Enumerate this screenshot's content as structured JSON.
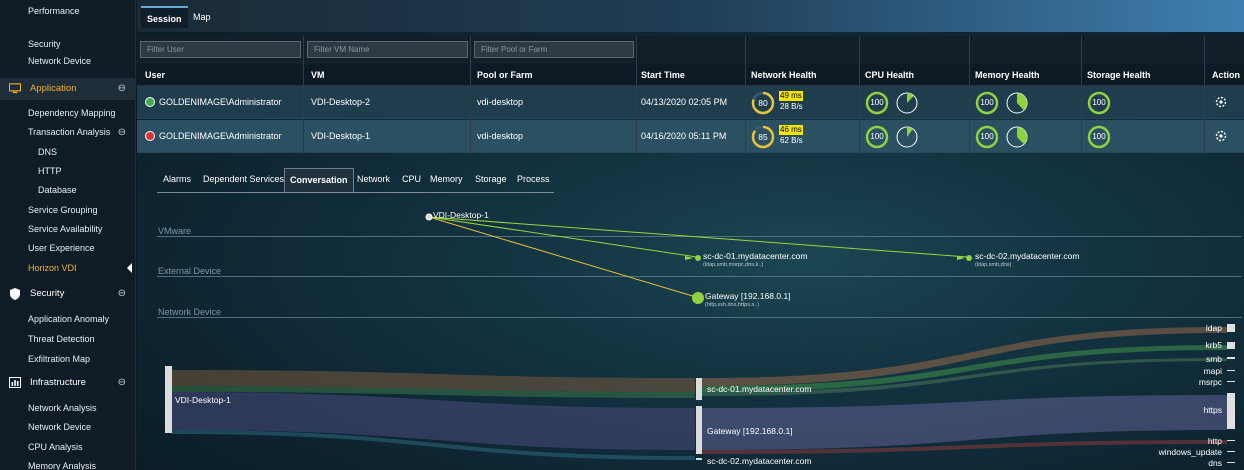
{
  "sidebar": {
    "items": [
      {
        "label": "Performance",
        "type": "item"
      },
      {
        "label": "Security",
        "type": "item"
      },
      {
        "label": "Network Device",
        "type": "item"
      },
      {
        "label": "Application",
        "type": "section",
        "icon": "monitor-icon",
        "active": true
      },
      {
        "label": "Dependency Mapping",
        "type": "item"
      },
      {
        "label": "Transaction Analysis",
        "type": "item-collapsible"
      },
      {
        "label": "DNS",
        "type": "sub"
      },
      {
        "label": "HTTP",
        "type": "sub"
      },
      {
        "label": "Database",
        "type": "sub"
      },
      {
        "label": "Service Grouping",
        "type": "item"
      },
      {
        "label": "Service Availability",
        "type": "item"
      },
      {
        "label": "User Experience",
        "type": "item"
      },
      {
        "label": "Horizon VDI",
        "type": "item",
        "active": true
      },
      {
        "label": "Security",
        "type": "section",
        "icon": "shield-icon"
      },
      {
        "label": "Application Anomaly",
        "type": "item"
      },
      {
        "label": "Threat Detection",
        "type": "item"
      },
      {
        "label": "Exfiltration Map",
        "type": "item"
      },
      {
        "label": "Infrastructure",
        "type": "section",
        "icon": "bar-chart-icon"
      },
      {
        "label": "Network Analysis",
        "type": "item"
      },
      {
        "label": "Network Device",
        "type": "item"
      },
      {
        "label": "CPU Analysis",
        "type": "item"
      },
      {
        "label": "Memory Analysis",
        "type": "item"
      }
    ],
    "collapse_glyph": "⊖"
  },
  "tabs": {
    "session": "Session",
    "map": "Map"
  },
  "filters": {
    "user": "Filter User",
    "vm": "Filter VM Name",
    "pool": "Filter Pool or Farm"
  },
  "columns": [
    "User",
    "VM",
    "Pool or Farm",
    "Start Time",
    "Network Health",
    "CPU Health",
    "Memory Health",
    "Storage Health",
    "Action"
  ],
  "rows": [
    {
      "status": "ok",
      "user": "GOLDENIMAGE\\Administrator",
      "vm": "VDI-Desktop-2",
      "pool": "vdi-desktop",
      "start": "04/13/2020 02:05 PM",
      "net_score": "80",
      "latency": "49 ms",
      "throughput": "28 B/s",
      "cpu_score": "100",
      "cpu_pie": 0.12,
      "mem_score": "100",
      "mem_pie": 0.38,
      "storage_score": "100"
    },
    {
      "status": "bad",
      "user": "GOLDENIMAGE\\Administrator",
      "vm": "VDI-Desktop-1",
      "pool": "vdi-desktop",
      "start": "04/16/2020 05:11 PM",
      "net_score": "85",
      "latency": "46 ms",
      "throughput": "62 B/s",
      "cpu_score": "100",
      "cpu_pie": 0.1,
      "mem_score": "100",
      "mem_pie": 0.38,
      "storage_score": "100"
    }
  ],
  "detail_tabs": [
    "Alarms",
    "Dependent Services",
    "Conversation",
    "Network",
    "CPU",
    "Memory",
    "Storage",
    "Process"
  ],
  "detail_active": "Conversation",
  "graph": {
    "lanes": [
      "VMware",
      "External Device",
      "Network Device"
    ],
    "source": "VDI-Desktop-1",
    "dc01": {
      "name": "sc-dc-01.mydatacenter.com",
      "protocols": "(ldap,smb,msrpc,dns,k..)"
    },
    "dc02": {
      "name": "sc-dc-02.mydatacenter.com",
      "protocols": "(ldap,smb,dns)"
    },
    "gateway": {
      "name": "Gateway [192.168.0.1]",
      "protocols": "(http,ssh,dns,https,s..)"
    }
  },
  "sankey": {
    "source": "VDI-Desktop-1",
    "middle": [
      "sc-dc-01.mydatacenter.com",
      "Gateway [192.168.0.1]",
      "sc-dc-02.mydatacenter.com"
    ],
    "right": [
      "ldap",
      "krb5",
      "smb",
      "mapi",
      "msrpc",
      "https",
      "http",
      "windows_update",
      "dns"
    ]
  },
  "colors": {
    "accent": "#f2b12c",
    "health_ring": "#8fd13f",
    "latency_bg": "#f5e600",
    "link_green": "#9ed43c",
    "link_yellow": "#e8c23a"
  }
}
